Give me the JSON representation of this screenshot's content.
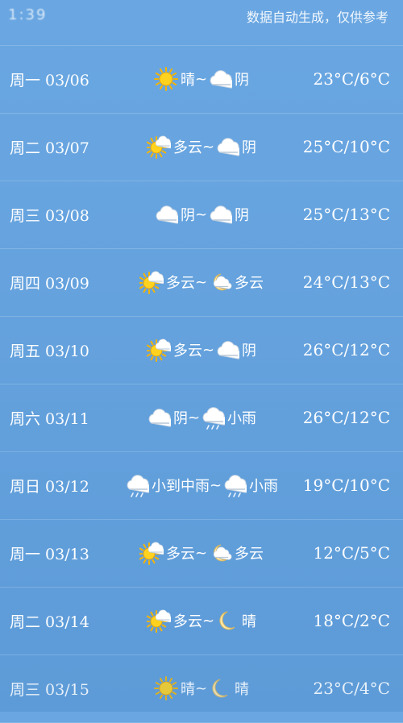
{
  "header": {
    "left_blur_text": "1:39",
    "note": "数据自动生成，仅供参考"
  },
  "rows": [
    {
      "day": "周一 03/06",
      "cond1": "晴",
      "icon1": "sun-icon",
      "cond2": "阴",
      "icon2": "cloud-icon",
      "temp": "23°C/6°C"
    },
    {
      "day": "周二 03/07",
      "cond1": "多云",
      "icon1": "partly-cloudy-sun-icon",
      "cond2": "阴",
      "icon2": "cloud-icon",
      "temp": "25°C/10°C"
    },
    {
      "day": "周三 03/08",
      "cond1": "阴",
      "icon1": "cloud-icon",
      "cond2": "阴",
      "icon2": "cloud-icon",
      "temp": "25°C/13°C"
    },
    {
      "day": "周四 03/09",
      "cond1": "多云",
      "icon1": "partly-cloudy-sun-icon",
      "cond2": "多云",
      "icon2": "partly-cloudy-moon-icon",
      "temp": "24°C/13°C"
    },
    {
      "day": "周五 03/10",
      "cond1": "多云",
      "icon1": "partly-cloudy-sun-icon",
      "cond2": "阴",
      "icon2": "cloud-icon",
      "temp": "26°C/12°C"
    },
    {
      "day": "周六 03/11",
      "cond1": "阴",
      "icon1": "cloud-icon",
      "cond2": "小雨",
      "icon2": "rain-cloud-icon",
      "temp": "26°C/12°C"
    },
    {
      "day": "周日 03/12",
      "cond1": "小到中雨",
      "icon1": "rain-cloud-icon",
      "cond2": "小雨",
      "icon2": "rain-cloud-icon",
      "temp": "19°C/10°C"
    },
    {
      "day": "周一 03/13",
      "cond1": "多云",
      "icon1": "partly-cloudy-sun-icon",
      "cond2": "多云",
      "icon2": "partly-cloudy-moon-icon",
      "temp": "12°C/5°C"
    },
    {
      "day": "周二 03/14",
      "cond1": "多云",
      "icon1": "partly-cloudy-sun-icon",
      "cond2": "晴",
      "icon2": "moon-icon",
      "temp": "18°C/2°C"
    },
    {
      "day": "周三 03/15",
      "cond1": "晴",
      "icon1": "sun-icon",
      "cond2": "晴",
      "icon2": "moon-icon",
      "temp": "23°C/4°C"
    }
  ],
  "separator": "~"
}
